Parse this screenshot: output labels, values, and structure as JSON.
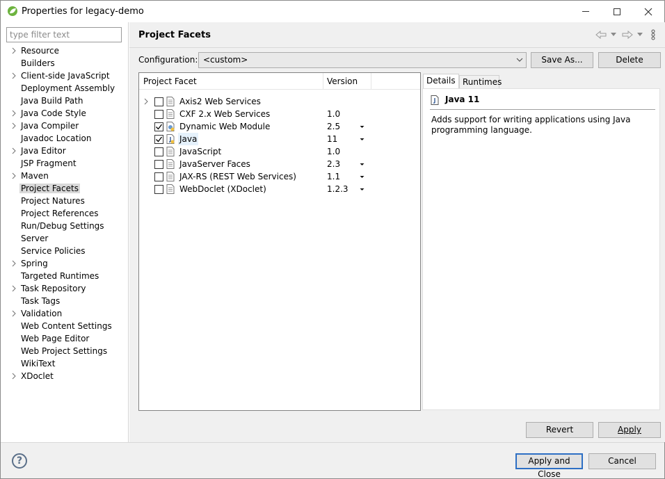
{
  "window": {
    "title": "Properties for legacy-demo"
  },
  "left": {
    "filter_placeholder": "type filter text",
    "items": [
      {
        "label": "Resource",
        "expandable": true
      },
      {
        "label": "Builders",
        "expandable": false
      },
      {
        "label": "Client-side JavaScript",
        "expandable": true
      },
      {
        "label": "Deployment Assembly",
        "expandable": false
      },
      {
        "label": "Java Build Path",
        "expandable": false
      },
      {
        "label": "Java Code Style",
        "expandable": true
      },
      {
        "label": "Java Compiler",
        "expandable": true
      },
      {
        "label": "Javadoc Location",
        "expandable": false
      },
      {
        "label": "Java Editor",
        "expandable": true
      },
      {
        "label": "JSP Fragment",
        "expandable": false
      },
      {
        "label": "Maven",
        "expandable": true
      },
      {
        "label": "Project Facets",
        "expandable": false,
        "selected": true
      },
      {
        "label": "Project Natures",
        "expandable": false
      },
      {
        "label": "Project References",
        "expandable": false
      },
      {
        "label": "Run/Debug Settings",
        "expandable": false
      },
      {
        "label": "Server",
        "expandable": false
      },
      {
        "label": "Service Policies",
        "expandable": false
      },
      {
        "label": "Spring",
        "expandable": true
      },
      {
        "label": "Targeted Runtimes",
        "expandable": false
      },
      {
        "label": "Task Repository",
        "expandable": true
      },
      {
        "label": "Task Tags",
        "expandable": false
      },
      {
        "label": "Validation",
        "expandable": true
      },
      {
        "label": "Web Content Settings",
        "expandable": false
      },
      {
        "label": "Web Page Editor",
        "expandable": false
      },
      {
        "label": "Web Project Settings",
        "expandable": false
      },
      {
        "label": "WikiText",
        "expandable": false
      },
      {
        "label": "XDoclet",
        "expandable": true
      }
    ]
  },
  "page": {
    "title": "Project Facets",
    "config_label": "Configuration:",
    "config_value": "<custom>",
    "save_as": "Save As...",
    "delete": "Delete"
  },
  "facets": {
    "col_facet": "Project Facet",
    "col_version": "Version",
    "rows": [
      {
        "name": "Axis2 Web Services",
        "version": "",
        "checked": false,
        "expandable": true,
        "dropdown": false
      },
      {
        "name": "CXF 2.x Web Services",
        "version": "1.0",
        "checked": false,
        "expandable": false,
        "dropdown": false
      },
      {
        "name": "Dynamic Web Module",
        "version": "2.5",
        "checked": true,
        "expandable": false,
        "dropdown": true
      },
      {
        "name": "Java",
        "version": "11",
        "checked": true,
        "expandable": false,
        "dropdown": true,
        "selected": true
      },
      {
        "name": "JavaScript",
        "version": "1.0",
        "checked": false,
        "expandable": false,
        "dropdown": false
      },
      {
        "name": "JavaServer Faces",
        "version": "2.3",
        "checked": false,
        "expandable": false,
        "dropdown": true
      },
      {
        "name": "JAX-RS (REST Web Services)",
        "version": "1.1",
        "checked": false,
        "expandable": false,
        "dropdown": true
      },
      {
        "name": "WebDoclet (XDoclet)",
        "version": "1.2.3",
        "checked": false,
        "expandable": false,
        "dropdown": true
      }
    ]
  },
  "details": {
    "tab_details": "Details",
    "tab_runtimes": "Runtimes",
    "title": "Java 11",
    "description": "Adds support for writing applications using Java programming language."
  },
  "buttons": {
    "revert": "Revert",
    "apply": "Apply",
    "apply_close": "Apply and Close",
    "cancel": "Cancel"
  },
  "help": "?"
}
